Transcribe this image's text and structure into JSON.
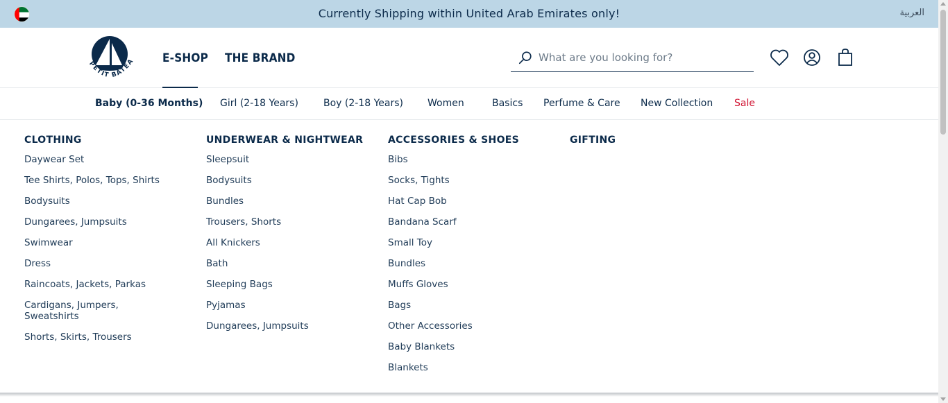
{
  "banner": {
    "message": "Currently Shipping within United Arab Emirates only!",
    "language_link": "العربية",
    "flag_icon": "uae-flag-icon"
  },
  "header": {
    "logo_text": "PETIT BATEAU",
    "nav": {
      "eshop": "E-SHOP",
      "brand": "THE BRAND"
    },
    "search": {
      "placeholder": "What are you looking for?"
    },
    "icons": [
      "wishlist-heart-icon",
      "account-icon",
      "shopping-bag-icon"
    ]
  },
  "catnav": {
    "items": [
      "Baby (0-36 Months)",
      "Girl (2-18 Years)",
      "Boy (2-18 Years)",
      "Women",
      "Basics",
      "Perfume & Care",
      "New Collection",
      "Sale"
    ]
  },
  "mega": {
    "clothing": {
      "title": "CLOTHING",
      "items": [
        "Daywear Set",
        "Tee Shirts, Polos, Tops, Shirts",
        "Bodysuits",
        "Dungarees, Jumpsuits",
        "Swimwear",
        "Dress",
        "Raincoats, Jackets, Parkas",
        "Cardigans, Jumpers, Sweatshirts",
        "Shorts, Skirts, Trousers"
      ]
    },
    "underwear": {
      "title": "UNDERWEAR & NIGHTWEAR",
      "items": [
        "Sleepsuit",
        "Bodysuits",
        "Bundles",
        "Trousers, Shorts",
        "All Knickers",
        "Bath",
        "Sleeping Bags",
        "Pyjamas",
        "Dungarees, Jumpsuits"
      ]
    },
    "accessories": {
      "title": "ACCESSORIES & SHOES",
      "items": [
        "Bibs",
        "Socks, Tights",
        "Hat Cap Bob",
        "Bandana Scarf",
        "Small Toy",
        "Bundles",
        "Muffs Gloves",
        "Bags",
        "Other Accessories",
        "Baby Blankets",
        "Blankets"
      ]
    },
    "gifting": {
      "title": "GIFTING"
    }
  },
  "colors": {
    "navy": "#0b2a4a",
    "banner_bg": "#bcd6e6",
    "sale_red": "#d0102f"
  }
}
